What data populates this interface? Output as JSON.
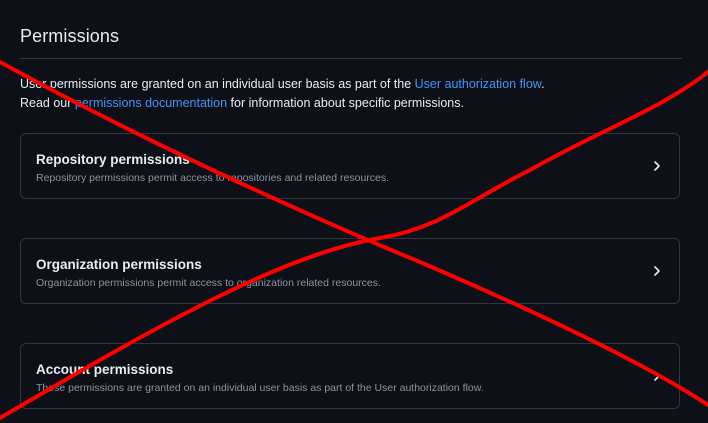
{
  "section": {
    "title": "Permissions"
  },
  "intro": {
    "line1_text": "User permissions are granted on an individual user basis as part of the ",
    "line1_link": "User authorization flow",
    "line1_end": ".",
    "line2_start": "Read our ",
    "line2_link": "permissions documentation",
    "line2_end": " for information about specific permissions."
  },
  "cards": [
    {
      "title": "Repository permissions",
      "description": "Repository permissions permit access to repositories and related resources."
    },
    {
      "title": "Organization permissions",
      "description": "Organization permissions permit access to organization related resources."
    },
    {
      "title": "Account permissions",
      "description": "These permissions are granted on an individual user basis as part of the User authorization flow."
    }
  ],
  "icons": {
    "chevron": "chevron-right-icon"
  },
  "colors": {
    "background": "#0d1117",
    "border": "#30363d",
    "link": "#4493f8",
    "text": "#e6edf3",
    "muted": "#8b949e",
    "overlay_cross": "#ff0000"
  }
}
